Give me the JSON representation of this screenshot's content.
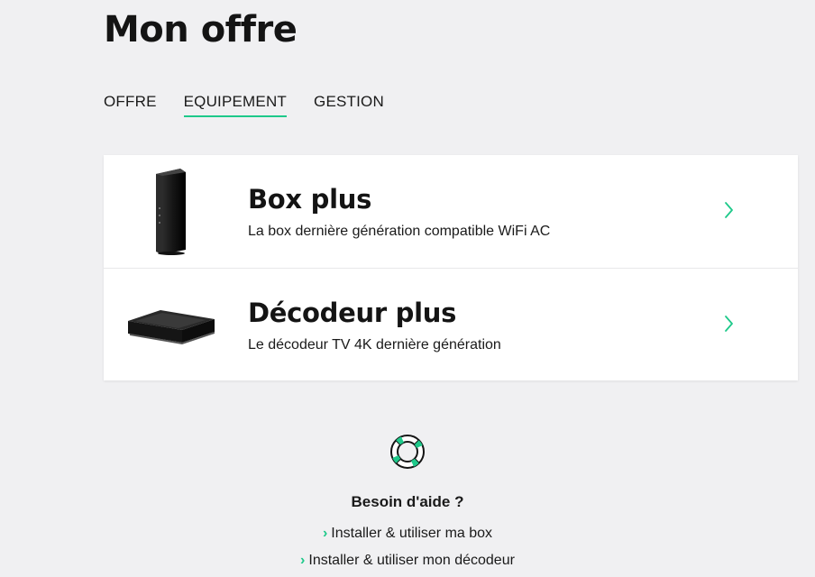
{
  "page": {
    "title": "Mon offre"
  },
  "tabs": [
    {
      "label": "OFFRE"
    },
    {
      "label": "EQUIPEMENT"
    },
    {
      "label": "GESTION"
    }
  ],
  "equipment": [
    {
      "title": "Box plus",
      "description": "La box dernière génération compatible WiFi AC",
      "icon": "router-image"
    },
    {
      "title": "Décodeur plus",
      "description": "Le décodeur TV 4K dernière génération",
      "icon": "decoder-image"
    }
  ],
  "help": {
    "icon": "lifebuoy-icon",
    "title": "Besoin d'aide ?",
    "links": [
      {
        "label": "Installer & utiliser ma box"
      },
      {
        "label": "Installer & utiliser mon décodeur"
      }
    ]
  },
  "colors": {
    "accent": "#1ec98a",
    "background": "#f0f0f2",
    "card": "#ffffff",
    "text": "#1a1a1a"
  }
}
